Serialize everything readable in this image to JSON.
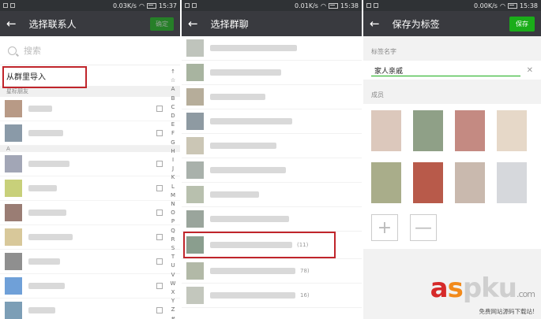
{
  "colors": {
    "topbar": "#393a3f",
    "status": "#2f3235",
    "accent_green": "#1aad19",
    "highlight_red": "#c0252b"
  },
  "panel1": {
    "status": {
      "speed": "0.03K/s",
      "time": "15:37"
    },
    "title": "选择联系人",
    "confirm_label": "确定",
    "search_placeholder": "搜索",
    "import_label": "从群里导入",
    "section_label": "星标朋友",
    "section2_label": "A",
    "index": [
      "↑",
      "☆",
      "A",
      "B",
      "C",
      "D",
      "E",
      "F",
      "G",
      "H",
      "I",
      "J",
      "K",
      "L",
      "M",
      "N",
      "O",
      "P",
      "Q",
      "R",
      "S",
      "T",
      "U",
      "V",
      "W",
      "X",
      "Y",
      "Z",
      "#"
    ]
  },
  "panel2": {
    "status": {
      "speed": "0.01K/s",
      "time": "15:38"
    },
    "title": "选择群聊",
    "groups": [
      {
        "count": ""
      },
      {
        "count": ""
      },
      {
        "count": ""
      },
      {
        "count": ""
      },
      {
        "count": ""
      },
      {
        "count": ""
      },
      {
        "count": ""
      },
      {
        "count": ""
      },
      {
        "count": "(11)"
      },
      {
        "count": "78)"
      },
      {
        "count": "16)"
      }
    ]
  },
  "panel3": {
    "status": {
      "speed": "0.00K/s",
      "time": "15:38"
    },
    "title": "保存为标签",
    "save_label": "保存",
    "tag_name_label": "标签名字",
    "tag_value": "家人亲戚",
    "members_label": "成员",
    "add_icon": "+",
    "remove_icon": "—"
  },
  "watermark": {
    "brand_a": "a",
    "brand_s": "s",
    "brand_p": "p",
    "brand_ku": "ku",
    "brand_com": ".com",
    "tagline": "免费网站源码下载站!"
  }
}
